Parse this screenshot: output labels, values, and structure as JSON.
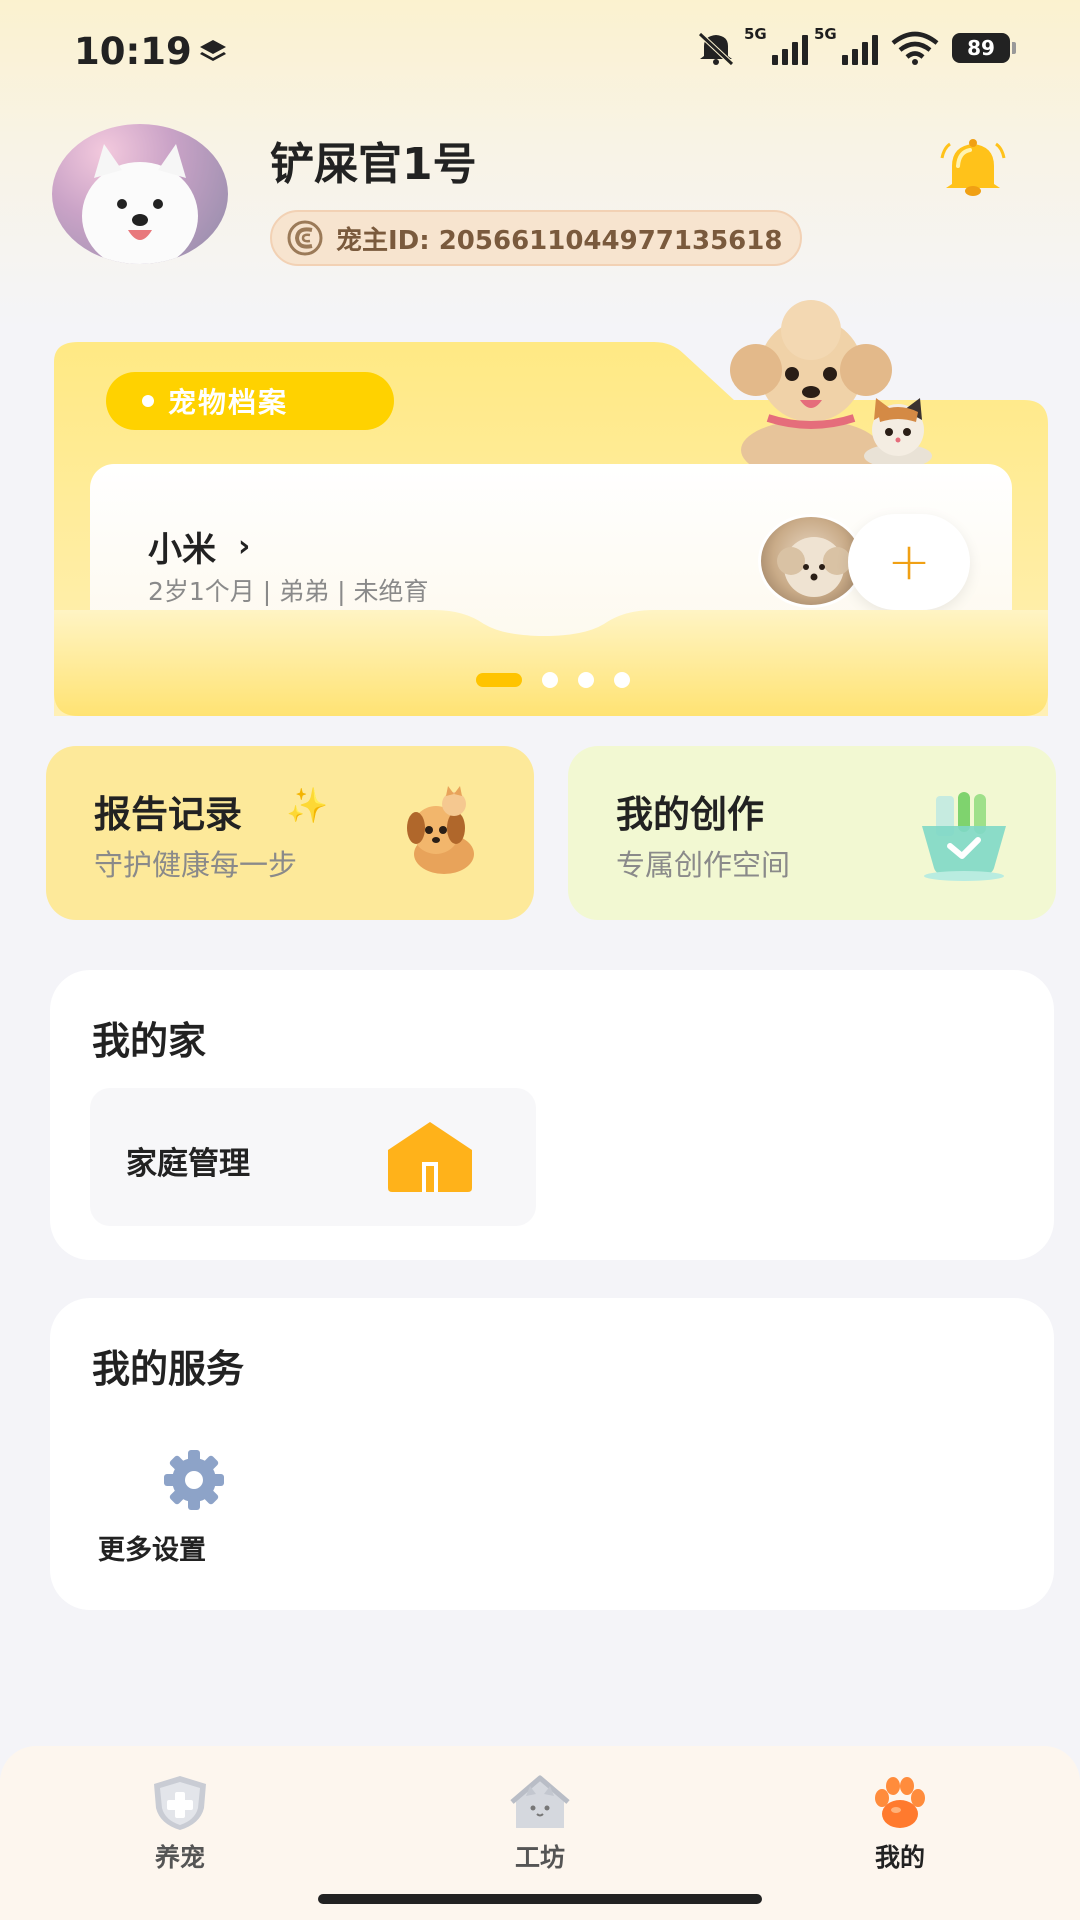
{
  "status_bar": {
    "time": "10:19",
    "network1": "5G",
    "network2": "5G",
    "battery": "89",
    "icons": [
      "layers-icon",
      "mute-icon",
      "signal-icon",
      "wifi-icon",
      "battery-icon"
    ]
  },
  "profile": {
    "username": "铲屎官1号",
    "id_label": "宠主ID: 2056611044977135618",
    "avatar": "samoyed-avatar",
    "notification_icon": "bell-icon"
  },
  "pet_archive": {
    "tag": "宠物档案",
    "pet_name": "小米",
    "pet_info": "2岁1个月 | 弟弟 | 未绝育",
    "add_label": "+",
    "pages": 4,
    "current_page": 1
  },
  "features": [
    {
      "title": "报告记录",
      "subtitle": "守护健康每一步",
      "icon": "puppy-icon"
    },
    {
      "title": "我的创作",
      "subtitle": "专属创作空间",
      "icon": "creation-basket-icon"
    }
  ],
  "my_home": {
    "title": "我的家",
    "item_label": "家庭管理",
    "item_icon": "house-icon"
  },
  "my_services": {
    "title": "我的服务",
    "item_label": "更多设置",
    "item_icon": "gear-icon"
  },
  "tabbar": {
    "items": [
      {
        "label": "养宠",
        "icon": "shield-icon"
      },
      {
        "label": "工坊",
        "icon": "cat-house-icon"
      },
      {
        "label": "我的",
        "icon": "paw-icon"
      }
    ],
    "active": 2
  },
  "colors": {
    "accent_yellow": "#ffd200",
    "orange": "#f0a014",
    "gear": "#8da3c8"
  }
}
